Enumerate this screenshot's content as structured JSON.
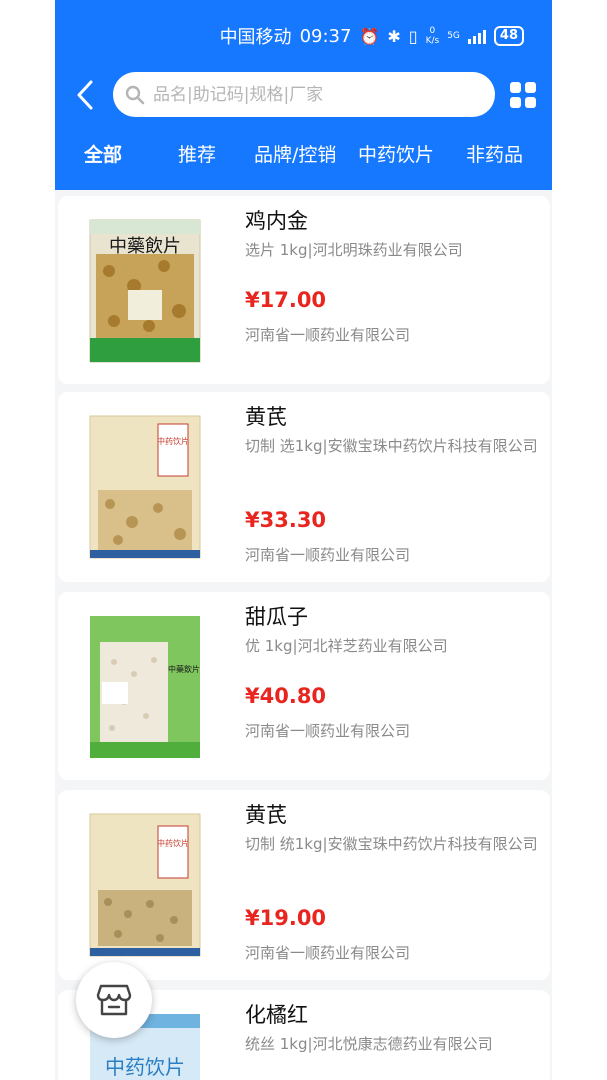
{
  "status_bar": {
    "carrier": "中国移动",
    "time": "09:37",
    "net_speed_value": "0",
    "net_speed_unit": "K/s",
    "network_type": "5G",
    "battery": "48"
  },
  "search": {
    "placeholder": "品名|助记码|规格|厂家"
  },
  "tabs": [
    {
      "label": "全部",
      "active": true
    },
    {
      "label": "推荐",
      "active": false
    },
    {
      "label": "品牌/控销",
      "active": false
    },
    {
      "label": "中药饮片",
      "active": false
    },
    {
      "label": "非药品",
      "active": false
    }
  ],
  "products": [
    {
      "name": "鸡内金",
      "spec": "选片 1kg|河北明珠药业有限公司",
      "price": "¥17.00",
      "vendor": "河南省一顺药业有限公司",
      "image_label": "中藥飲片"
    },
    {
      "name": "黄芪",
      "spec": "切制 选1kg|安徽宝珠中药饮片科技有限公司",
      "price": "¥33.30",
      "vendor": "河南省一顺药业有限公司",
      "image_label": "中药饮片"
    },
    {
      "name": "甜瓜子",
      "spec": "优 1kg|河北祥芝药业有限公司",
      "price": "¥40.80",
      "vendor": "河南省一顺药业有限公司",
      "image_label": "中藥飲片"
    },
    {
      "name": "黄芪",
      "spec": "切制 统1kg|安徽宝珠中药饮片科技有限公司",
      "price": "¥19.00",
      "vendor": "河南省一顺药业有限公司",
      "image_label": "中药饮片"
    },
    {
      "name": "化橘红",
      "spec": "统丝 1kg|河北悦康志德药业有限公司",
      "price": "",
      "vendor": "",
      "image_label": "中药饮片"
    }
  ],
  "colors": {
    "header_blue": "#1677ff",
    "price_red": "#e8251f",
    "background": "#f4f5f7"
  },
  "icons": {
    "back": "chevron-left-icon",
    "search": "search-icon",
    "grid": "grid-icon",
    "store": "store-icon"
  }
}
